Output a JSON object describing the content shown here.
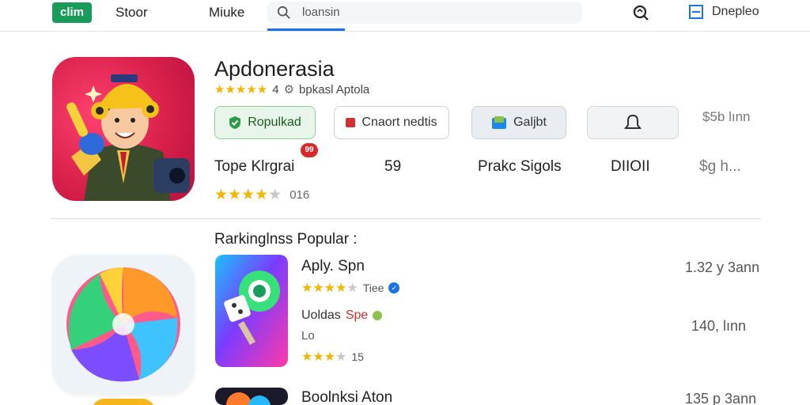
{
  "header": {
    "logo_text": "clim",
    "nav": [
      "Stoor",
      "Miuke"
    ],
    "search_placeholder": "loansin",
    "device_label": "Dnepleo"
  },
  "hero": {
    "title": "Apdonerasia",
    "subtitle": "bpkasl Aptola",
    "subtitle_prefix": "4",
    "buttons": {
      "install": "Ropulkad",
      "wishlist": "Cnaort nedtis",
      "share": "Galjbt"
    },
    "price_top": "$5b lınn",
    "stats": {
      "label": "Tope Klrgrai",
      "badge": "99",
      "count": "59",
      "category": "Prakc Sigols",
      "code": "DIIOII",
      "price": "$g h..."
    },
    "rating": {
      "stars_filled": 4,
      "stars_total": 5,
      "count": "016"
    }
  },
  "section": {
    "title": "Rarkinglnss Popular :"
  },
  "list": [
    {
      "name": "Aply. Spn",
      "meta_text": "Tiee",
      "rating_filled": 4,
      "size": "1.32 y 3ann",
      "developer": "Uoldas",
      "developer_tag": "Spe",
      "extra_line": "Lo",
      "rating2_filled": 3,
      "rating2_count": "15",
      "size2": "140, lınn"
    },
    {
      "name": "Boolnksi Aton",
      "size": "135 p 3ann"
    }
  ],
  "colors": {
    "accent": "#1a73e8",
    "brand": "#1b9b5a",
    "star": "#f5b400",
    "hero_icon": "#d8204a"
  }
}
